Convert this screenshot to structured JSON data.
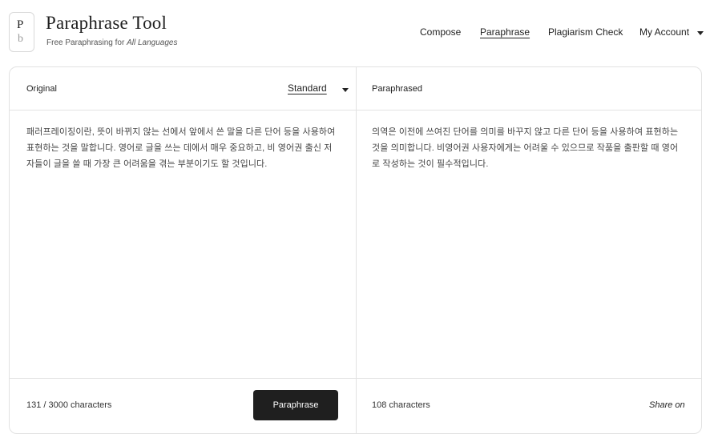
{
  "brand": {
    "logo_top": "P",
    "logo_bottom": "b",
    "title": "Paraphrase Tool",
    "subtitle_prefix": "Free Paraphrasing for ",
    "subtitle_emphasis": "All Languages"
  },
  "nav": {
    "items": [
      {
        "label": "Compose"
      },
      {
        "label": "Paraphrase",
        "active": true
      },
      {
        "label": "Plagiarism Check"
      },
      {
        "label": "My Account"
      }
    ]
  },
  "original": {
    "label": "Original",
    "mode": "Standard",
    "text": "패러프레이징이란, 뜻이 바뀌지 않는 선에서 앞에서 쓴 말을 다른 단어 등을 사용하여 표현하는 것을 말합니다. 영어로 글을 쓰는 데에서 매우 중요하고, 비 영어권 출신 저자들이 글을 쓸 때 가장 큰 어려움을 겪는 부분이기도 할 것입니다.",
    "char_count": "131 / 3000 characters",
    "button_label": "Paraphrase"
  },
  "paraphrased": {
    "label": "Paraphrased",
    "text": "의역은 이전에 쓰여진 단어를 의미를 바꾸지 않고 다른 단어 등을 사용하여 표현하는 것을 의미합니다. 비영어권 사용자에게는 어려울 수 있으므로 작품을 출판할 때 영어로 작성하는 것이 필수적입니다.",
    "char_count": "108 characters",
    "share_label": "Share on"
  }
}
